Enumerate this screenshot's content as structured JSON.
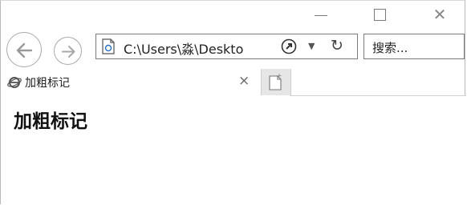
{
  "window": {
    "minimize_glyph": "—",
    "close_glyph": "✕"
  },
  "nav": {
    "back_icon": "back-arrow-icon",
    "forward_icon": "forward-arrow-icon",
    "address": "C:\\Users\\淼\\Deskto",
    "dropdown_glyph": "▼",
    "refresh_glyph": "↻",
    "search_placeholder": "搜索..."
  },
  "tabs": [
    {
      "title": "加粗标记",
      "close_glyph": "×",
      "icon": "ie-icon"
    }
  ],
  "content": {
    "heading": "加粗标记"
  },
  "colors": {
    "border": "#7a7a7a",
    "newtab_bg": "#e6e6e6",
    "text": "#111111"
  }
}
